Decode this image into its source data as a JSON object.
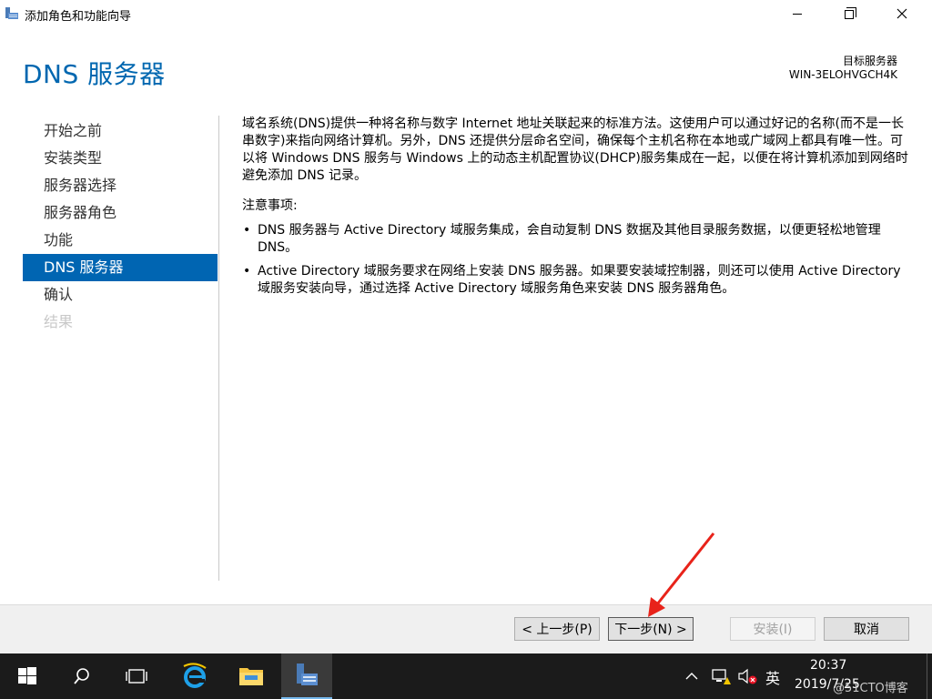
{
  "window": {
    "title": "添加角色和功能向导",
    "icon": "server-manager-icon"
  },
  "header": {
    "page_title": "DNS 服务器",
    "target_label": "目标服务器",
    "target_name": "WIN-3ELOHVGCH4K"
  },
  "nav": {
    "items": [
      {
        "label": "开始之前",
        "state": "normal"
      },
      {
        "label": "安装类型",
        "state": "normal"
      },
      {
        "label": "服务器选择",
        "state": "normal"
      },
      {
        "label": "服务器角色",
        "state": "normal"
      },
      {
        "label": "功能",
        "state": "normal"
      },
      {
        "label": "DNS 服务器",
        "state": "active"
      },
      {
        "label": "确认",
        "state": "normal"
      },
      {
        "label": "结果",
        "state": "disabled"
      }
    ]
  },
  "content": {
    "intro": "域名系统(DNS)提供一种将名称与数字 Internet 地址关联起来的标准方法。这使用户可以通过好记的名称(而不是一长串数字)来指向网络计算机。另外，DNS 还提供分层命名空间，确保每个主机名称在本地或广域网上都具有唯一性。可以将 Windows DNS 服务与 Windows 上的动态主机配置协议(DHCP)服务集成在一起，以便在将计算机添加到网络时避免添加 DNS 记录。",
    "notes_heading": "注意事项:",
    "notes": [
      "DNS 服务器与 Active Directory 域服务集成，会自动复制 DNS 数据及其他目录服务数据，以便更轻松地管理 DNS。",
      "Active Directory 域服务要求在网络上安装 DNS 服务器。如果要安装域控制器，则还可以使用 Active Directory 域服务安装向导，通过选择 Active Directory 域服务角色来安装 DNS 服务器角色。"
    ]
  },
  "buttons": {
    "prev": "< 上一步(P)",
    "next": "下一步(N) >",
    "install": "安装(I)",
    "cancel": "取消"
  },
  "taskbar": {
    "lang": "英",
    "time": "20:37",
    "date": "2019/7/25",
    "watermark": "@51CTO博客"
  },
  "colors": {
    "accent": "#0067b0",
    "nav_active": "#0065b2",
    "annotation": "#e8231a"
  }
}
